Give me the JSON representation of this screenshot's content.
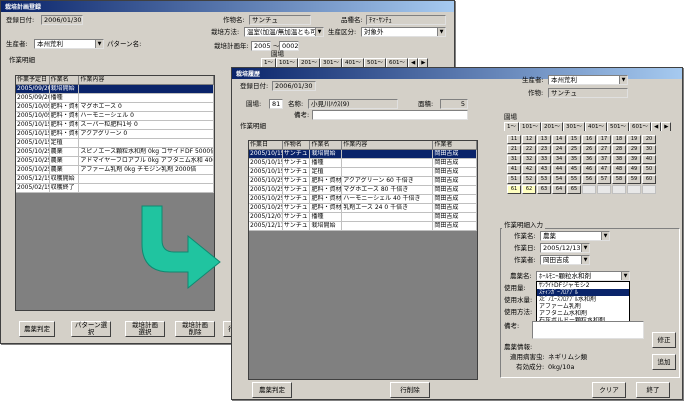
{
  "back": {
    "title": "栽培計画登録",
    "reg_date_label": "登録日付:",
    "reg_date": "2006/01/30",
    "crop_label": "作物名:",
    "crop": "サンチュ",
    "variety_label": "品種名:",
    "variety": "ﾁﾏ･ｻﾝﾁｭ",
    "producer_label": "生産者:",
    "producer": "本州荒利",
    "pattern_label": "パターン名:",
    "method_label": "栽培方法:",
    "method": "温室(加温/無加温とも可)",
    "class_label": "生産区分:",
    "class": "対象外",
    "year_label": "栽培計画年:",
    "year_from": "2005",
    "year_to": "0002",
    "room_label": "園場",
    "tabs": [
      "1〜",
      "101〜",
      "201〜",
      "301〜",
      "401〜",
      "501〜",
      "601〜"
    ],
    "detail_label": "作業明細",
    "headers": [
      "作業予定日",
      "作業名",
      "作業内容"
    ],
    "rows": [
      [
        "2005/09/20",
        "栽培開始",
        ""
      ],
      [
        "2005/09/20",
        "播種",
        ""
      ],
      [
        "2005/10/05",
        "肥料・資材",
        "マグホエース 0"
      ],
      [
        "2005/10/05",
        "肥料・資材",
        "ハーモニーシェル 0"
      ],
      [
        "2005/10/15",
        "肥料・資材",
        "スーパー粒肥料1号 0"
      ],
      [
        "2005/10/15",
        "肥料・資材",
        "アクアグリーン 0"
      ],
      [
        "2005/10/15",
        "定植",
        ""
      ],
      [
        "2005/10/25",
        "農薬",
        "スピノエース顆粒水和剤 0kg  コサイドDF 5000倍"
      ],
      [
        "2005/10/25",
        "農薬",
        "アドマイヤーフロアブル 0kg  アフタニム水和 4000倍"
      ],
      [
        "2005/10/25",
        "農薬",
        "アファーム乳剤 0kg  チモジン乳剤 2000倍"
      ],
      [
        "2005/12/15",
        "収穫開始",
        ""
      ],
      [
        "2005/02/15",
        "収穫終了",
        ""
      ]
    ],
    "buttons": [
      "農薬判定",
      "パターン選択",
      "栽培計画\n選択",
      "栽培計画\n削除",
      "行削除"
    ]
  },
  "front": {
    "title": "栽培履歴",
    "reg_date_label": "登録日付:",
    "reg_date": "2006/01/30",
    "room_label": "園場:",
    "room_no": "81",
    "room_name_label": "名称:",
    "room_name": "小見川ﾊｳｽ(9)",
    "area_label": "面積:",
    "area": "5",
    "note_label": "備考:",
    "producer_label": "生産者:",
    "producer": "本州荒利",
    "crop_label": "作物:",
    "crop": "サンチュ",
    "room_tab_label": "園場",
    "tabs": [
      "1〜",
      "101〜",
      "201〜",
      "301〜",
      "401〜",
      "501〜",
      "601〜"
    ],
    "rooms": [
      "11",
      "12",
      "13",
      "14",
      "15",
      "16",
      "17",
      "18",
      "19",
      "20",
      "21",
      "22",
      "23",
      "24",
      "25",
      "26",
      "27",
      "28",
      "29",
      "30",
      "31",
      "32",
      "33",
      "34",
      "35",
      "36",
      "37",
      "38",
      "39",
      "40",
      "41",
      "42",
      "43",
      "44",
      "45",
      "46",
      "47",
      "48",
      "49",
      "50",
      "51",
      "52",
      "53",
      "54",
      "55",
      "56",
      "57",
      "58",
      "59",
      "60",
      "61",
      "62",
      "63",
      "64",
      "65",
      "",
      "",
      "",
      "",
      ""
    ],
    "detail_label": "作業明細",
    "headers": [
      "作業日",
      "作物名",
      "作業名",
      "作業内容",
      "作業者"
    ],
    "rows": [
      [
        "2005/10/15",
        "サンチュ",
        "栽培開始",
        "",
        "岡田吉成"
      ],
      [
        "2005/10/15",
        "サンチュ",
        "播種",
        "",
        "岡田吉成"
      ],
      [
        "2005/10/15",
        "サンチュ",
        "定植",
        "",
        "岡田吉成"
      ],
      [
        "2005/10/25",
        "サンチュ",
        "肥料・資材",
        "アクアグリーン 60 千倍き",
        "岡田吉成"
      ],
      [
        "2005/10/25",
        "サンチュ",
        "肥料・資材",
        "マグホエース 80 千倍き",
        "岡田吉成"
      ],
      [
        "2005/10/25",
        "サンチュ",
        "肥料・資材",
        "ハーモニーシェル 40 千倍き",
        "岡田吉成"
      ],
      [
        "2005/10/25",
        "サンチュ",
        "肥料・資材",
        "乳剤エース 24 0 千倍き",
        "岡田吉成"
      ],
      [
        "2005/12/01",
        "サンチュ",
        "播種",
        "",
        "岡田吉成"
      ],
      [
        "2005/12/13",
        "サンチュ",
        "栽培開始",
        "",
        "岡田吉成"
      ]
    ],
    "input_label": "作業明細入力",
    "task_label": "作業名:",
    "task": "農薬",
    "date_label": "作業日:",
    "date": "2005/12/13",
    "worker_label": "作業者:",
    "worker": "岡田吉成",
    "pesticide_label": "農薬名:",
    "pesticide": "ﾎｰﾙﾓﾆｰ顆粒水和剤",
    "pesticide_options": [
      "ｻﾝﾗｲﾄDFジャモシ2",
      "ｽﾃｨﾝｶﾞｰﾌﾛｱﾌﾞﾙ",
      "ｽﾋﾟﾉｴｰｽﾌﾛｱﾌﾞﾙ水和剤",
      "アファーム乳剤",
      "アフタニム水和剤",
      "石灰ボルドー顆粒水和剤",
      "ﾀﾞｲｱｼﾞﾉﾝﾌﾛｱﾌﾞﾙ水和剤",
      "日曹スピノエース剤水和剤"
    ],
    "use_amount_label": "使用量:",
    "dilution_label": "使用水量:",
    "method_label": "使用方法:",
    "note2_label": "備考:",
    "rule_label": "農薬情報:",
    "rule1_label": "適用病害虫:",
    "rule1": "ネギリムシ類",
    "rule2_label": "有効成分:",
    "rule2": "0kg/10a",
    "edit_button": "修正",
    "add_button": "追加",
    "bottom_buttons": [
      "農薬判定",
      "行削除",
      "クリア",
      "終了"
    ]
  }
}
